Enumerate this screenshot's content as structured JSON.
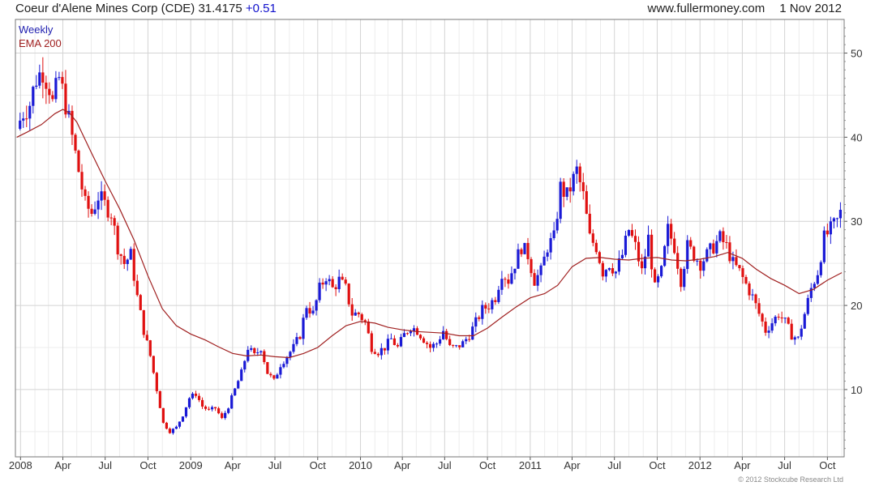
{
  "header": {
    "ticker_label": "Coeur d'Alene Mines Corp (CDE) 31.4175",
    "change": "+0.51",
    "site": "www.fullermoney.com",
    "date": "1 Nov 2012"
  },
  "footer": {
    "copyright": "© 2012 Stockcube Research Ltd"
  },
  "colors": {
    "up": "#1a1ad6",
    "down": "#e01010",
    "ema": "#a02020",
    "grid": "#d4d4d4",
    "axis": "#555555"
  },
  "chart_data": {
    "type": "candlestick",
    "title": "Coeur d'Alene Mines Corp (CDE) 31.4175 +0.51",
    "frequency_label": "Weekly",
    "overlay_label": "EMA 200",
    "ylim": [
      2,
      54
    ],
    "y_ticks": [
      10,
      20,
      30,
      40,
      50
    ],
    "x_ticks": [
      {
        "label": "2008",
        "date": "2008-01-01"
      },
      {
        "label": "Apr",
        "date": "2008-04-01"
      },
      {
        "label": "Jul",
        "date": "2008-07-01"
      },
      {
        "label": "Oct",
        "date": "2008-10-01"
      },
      {
        "label": "2009",
        "date": "2009-01-01"
      },
      {
        "label": "Apr",
        "date": "2009-04-01"
      },
      {
        "label": "Jul",
        "date": "2009-07-01"
      },
      {
        "label": "Oct",
        "date": "2009-10-01"
      },
      {
        "label": "2010",
        "date": "2010-01-01"
      },
      {
        "label": "Apr",
        "date": "2010-04-01"
      },
      {
        "label": "Jul",
        "date": "2010-07-01"
      },
      {
        "label": "Oct",
        "date": "2010-10-01"
      },
      {
        "label": "2011",
        "date": "2011-01-01"
      },
      {
        "label": "Apr",
        "date": "2011-04-01"
      },
      {
        "label": "Jul",
        "date": "2011-07-01"
      },
      {
        "label": "Oct",
        "date": "2011-10-01"
      },
      {
        "label": "2012",
        "date": "2012-01-01"
      },
      {
        "label": "Apr",
        "date": "2012-04-01"
      },
      {
        "label": "Jul",
        "date": "2012-07-01"
      },
      {
        "label": "Oct",
        "date": "2012-10-01"
      }
    ],
    "close_path": [
      [
        "2007-12-24",
        41
      ],
      [
        "2008-01-07",
        43
      ],
      [
        "2008-01-21",
        44
      ],
      [
        "2008-02-04",
        47
      ],
      [
        "2008-02-18",
        48
      ],
      [
        "2008-03-03",
        46
      ],
      [
        "2008-03-10",
        44
      ],
      [
        "2008-03-24",
        47
      ],
      [
        "2008-04-07",
        44
      ],
      [
        "2008-04-21",
        40
      ],
      [
        "2008-05-05",
        36
      ],
      [
        "2008-05-19",
        32
      ],
      [
        "2008-06-02",
        31
      ],
      [
        "2008-06-16",
        33
      ],
      [
        "2008-06-30",
        32
      ],
      [
        "2008-07-14",
        31
      ],
      [
        "2008-07-28",
        27
      ],
      [
        "2008-08-11",
        25
      ],
      [
        "2008-08-25",
        26
      ],
      [
        "2008-09-08",
        21
      ],
      [
        "2008-09-22",
        17
      ],
      [
        "2008-10-06",
        14
      ],
      [
        "2008-10-20",
        10
      ],
      [
        "2008-11-03",
        6
      ],
      [
        "2008-11-17",
        5
      ],
      [
        "2008-12-01",
        5.5
      ],
      [
        "2008-12-15",
        7
      ],
      [
        "2008-12-29",
        9
      ],
      [
        "2009-01-12",
        9.5
      ],
      [
        "2009-01-26",
        8
      ],
      [
        "2009-02-09",
        7.5
      ],
      [
        "2009-02-23",
        7.8
      ],
      [
        "2009-03-09",
        6.5
      ],
      [
        "2009-03-23",
        8
      ],
      [
        "2009-04-06",
        10
      ],
      [
        "2009-04-20",
        12
      ],
      [
        "2009-05-04",
        15
      ],
      [
        "2009-05-18",
        14
      ],
      [
        "2009-06-01",
        15
      ],
      [
        "2009-06-15",
        12
      ],
      [
        "2009-06-29",
        11
      ],
      [
        "2009-07-13",
        13
      ],
      [
        "2009-07-27",
        14
      ],
      [
        "2009-08-10",
        15
      ],
      [
        "2009-08-24",
        16.5
      ],
      [
        "2009-09-07",
        20
      ],
      [
        "2009-09-21",
        19
      ],
      [
        "2009-10-05",
        22
      ],
      [
        "2009-10-19",
        23.5
      ],
      [
        "2009-11-02",
        22
      ],
      [
        "2009-11-16",
        23
      ],
      [
        "2009-11-30",
        22
      ],
      [
        "2009-12-14",
        19
      ],
      [
        "2009-12-28",
        19
      ],
      [
        "2010-01-11",
        18
      ],
      [
        "2010-01-25",
        15
      ],
      [
        "2010-02-08",
        14.5
      ],
      [
        "2010-02-22",
        15
      ],
      [
        "2010-03-08",
        16
      ],
      [
        "2010-03-22",
        15
      ],
      [
        "2010-04-05",
        16.5
      ],
      [
        "2010-04-19",
        17.5
      ],
      [
        "2010-05-03",
        17
      ],
      [
        "2010-05-17",
        16
      ],
      [
        "2010-05-31",
        15
      ],
      [
        "2010-06-14",
        15.5
      ],
      [
        "2010-06-28",
        17
      ],
      [
        "2010-07-12",
        15
      ],
      [
        "2010-07-26",
        15
      ],
      [
        "2010-08-09",
        15.5
      ],
      [
        "2010-08-23",
        16.5
      ],
      [
        "2010-09-06",
        18
      ],
      [
        "2010-09-20",
        19.5
      ],
      [
        "2010-10-04",
        20
      ],
      [
        "2010-10-18",
        21
      ],
      [
        "2010-11-01",
        24
      ],
      [
        "2010-11-15",
        23
      ],
      [
        "2010-11-29",
        25
      ],
      [
        "2010-12-13",
        27
      ],
      [
        "2010-12-27",
        26
      ],
      [
        "2011-01-10",
        23
      ],
      [
        "2011-01-24",
        24
      ],
      [
        "2011-02-07",
        27
      ],
      [
        "2011-02-21",
        28
      ],
      [
        "2011-03-07",
        34
      ],
      [
        "2011-03-21",
        33
      ],
      [
        "2011-04-04",
        35
      ],
      [
        "2011-04-11",
        36
      ],
      [
        "2011-04-25",
        33
      ],
      [
        "2011-05-09",
        28
      ],
      [
        "2011-05-23",
        27
      ],
      [
        "2011-06-06",
        24
      ],
      [
        "2011-06-20",
        25
      ],
      [
        "2011-07-04",
        24
      ],
      [
        "2011-07-18",
        26
      ],
      [
        "2011-08-01",
        29
      ],
      [
        "2011-08-15",
        27
      ],
      [
        "2011-08-29",
        24
      ],
      [
        "2011-09-12",
        28
      ],
      [
        "2011-09-26",
        22
      ],
      [
        "2011-10-10",
        24
      ],
      [
        "2011-10-24",
        29
      ],
      [
        "2011-11-07",
        27
      ],
      [
        "2011-11-21",
        23
      ],
      [
        "2011-12-05",
        27
      ],
      [
        "2011-12-19",
        26
      ],
      [
        "2012-01-02",
        25
      ],
      [
        "2012-01-16",
        26
      ],
      [
        "2012-01-30",
        27
      ],
      [
        "2012-02-13",
        28
      ],
      [
        "2012-02-27",
        27
      ],
      [
        "2012-03-12",
        25
      ],
      [
        "2012-03-26",
        24
      ],
      [
        "2012-04-09",
        22.5
      ],
      [
        "2012-04-23",
        21
      ],
      [
        "2012-05-07",
        19
      ],
      [
        "2012-05-21",
        17
      ],
      [
        "2012-06-04",
        18
      ],
      [
        "2012-06-18",
        19
      ],
      [
        "2012-07-02",
        18
      ],
      [
        "2012-07-16",
        16.5
      ],
      [
        "2012-07-30",
        16
      ],
      [
        "2012-08-13",
        19
      ],
      [
        "2012-08-27",
        22
      ],
      [
        "2012-09-10",
        24
      ],
      [
        "2012-09-24",
        28
      ],
      [
        "2012-10-08",
        29
      ],
      [
        "2012-10-22",
        30
      ],
      [
        "2012-11-01",
        31.4
      ]
    ],
    "ema_path": [
      [
        "2007-12-24",
        40
      ],
      [
        "2008-01-15",
        40.6
      ],
      [
        "2008-02-15",
        41.5
      ],
      [
        "2008-03-15",
        42.8
      ],
      [
        "2008-04-01",
        43.3
      ],
      [
        "2008-04-15",
        42.9
      ],
      [
        "2008-05-01",
        41.8
      ],
      [
        "2008-06-01",
        38.2
      ],
      [
        "2008-07-01",
        34.8
      ],
      [
        "2008-08-01",
        31.5
      ],
      [
        "2008-09-01",
        27.8
      ],
      [
        "2008-10-01",
        23.5
      ],
      [
        "2008-11-01",
        19.6
      ],
      [
        "2008-12-01",
        17.6
      ],
      [
        "2009-01-01",
        16.6
      ],
      [
        "2009-02-01",
        15.9
      ],
      [
        "2009-03-01",
        15.1
      ],
      [
        "2009-04-01",
        14.3
      ],
      [
        "2009-05-01",
        14.0
      ],
      [
        "2009-06-01",
        14.1
      ],
      [
        "2009-07-01",
        13.9
      ],
      [
        "2009-08-01",
        13.8
      ],
      [
        "2009-09-01",
        14.3
      ],
      [
        "2009-10-01",
        15.0
      ],
      [
        "2009-11-01",
        16.4
      ],
      [
        "2009-12-01",
        17.6
      ],
      [
        "2010-01-01",
        18.1
      ],
      [
        "2010-02-01",
        17.9
      ],
      [
        "2010-03-01",
        17.4
      ],
      [
        "2010-04-01",
        17.1
      ],
      [
        "2010-05-01",
        16.9
      ],
      [
        "2010-06-01",
        16.8
      ],
      [
        "2010-07-01",
        16.7
      ],
      [
        "2010-08-01",
        16.4
      ],
      [
        "2010-09-01",
        16.4
      ],
      [
        "2010-10-01",
        17.3
      ],
      [
        "2010-11-01",
        18.6
      ],
      [
        "2010-12-01",
        19.8
      ],
      [
        "2011-01-01",
        20.9
      ],
      [
        "2011-02-01",
        21.4
      ],
      [
        "2011-03-01",
        22.4
      ],
      [
        "2011-04-01",
        24.6
      ],
      [
        "2011-05-01",
        25.6
      ],
      [
        "2011-06-01",
        25.7
      ],
      [
        "2011-07-01",
        25.5
      ],
      [
        "2011-08-01",
        25.4
      ],
      [
        "2011-09-01",
        25.6
      ],
      [
        "2011-10-01",
        25.7
      ],
      [
        "2011-11-01",
        25.4
      ],
      [
        "2011-12-01",
        25.3
      ],
      [
        "2012-01-01",
        25.5
      ],
      [
        "2012-02-01",
        25.8
      ],
      [
        "2012-03-01",
        26.3
      ],
      [
        "2012-04-01",
        25.6
      ],
      [
        "2012-05-01",
        24.3
      ],
      [
        "2012-06-01",
        23.2
      ],
      [
        "2012-07-01",
        22.4
      ],
      [
        "2012-08-01",
        21.4
      ],
      [
        "2012-09-01",
        21.9
      ],
      [
        "2012-10-01",
        23.0
      ],
      [
        "2012-11-01",
        23.9
      ]
    ]
  }
}
